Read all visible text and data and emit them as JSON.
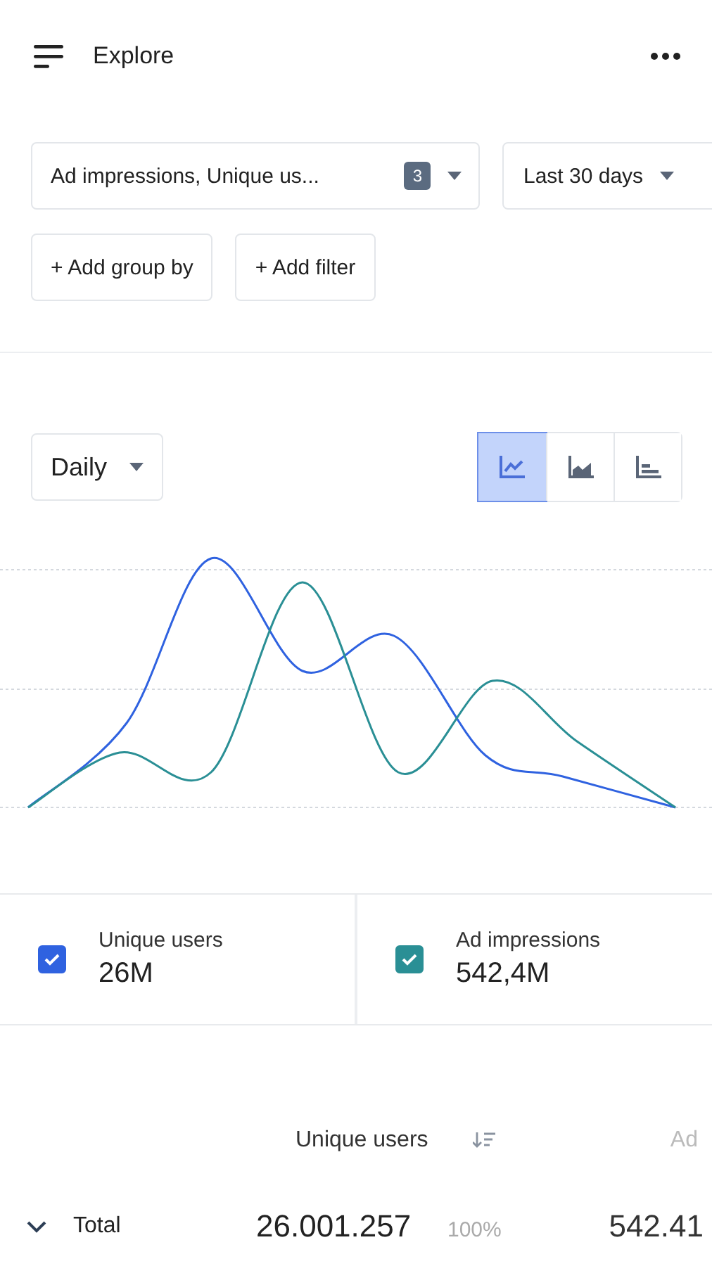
{
  "header": {
    "title": "Explore"
  },
  "metrics_select": {
    "label": "Ad impressions, Unique us...",
    "count": "3"
  },
  "range_select": {
    "label": "Last 30 days"
  },
  "actions": [
    "+ Add group by",
    "+ Add filter"
  ],
  "interval_select": {
    "label": "Daily"
  },
  "chart_types": [
    {
      "kind": "line",
      "selected": true
    },
    {
      "kind": "area",
      "selected": false
    },
    {
      "kind": "bar",
      "selected": false
    }
  ],
  "legend": [
    {
      "name": "Unique users",
      "value": "26M",
      "checked": true,
      "color": "#2f62e0"
    },
    {
      "name": "Ad impressions",
      "value": "542,4M",
      "checked": true,
      "color": "#2a8f95"
    }
  ],
  "table": {
    "columns": [
      "",
      "Unique users",
      "",
      "Ad"
    ],
    "rows": [
      {
        "expanded": true,
        "cells": [
          "Total",
          "26.001.257",
          "100%",
          "542.41"
        ]
      }
    ]
  }
}
